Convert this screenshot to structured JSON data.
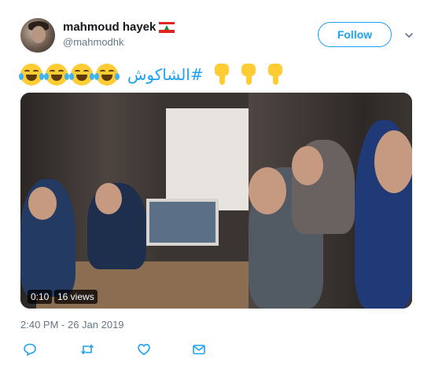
{
  "user": {
    "display_name": "mahmoud hayek",
    "handle": "@mahmodhk"
  },
  "follow_button": {
    "label": "Follow"
  },
  "tweet": {
    "hashtag": "#الشاكوش",
    "leading_emoji": [
      "face-with-tears-of-joy-icon",
      "face-with-tears-of-joy-icon",
      "face-with-tears-of-joy-icon",
      "face-with-tears-of-joy-icon"
    ],
    "trailing_emoji": [
      "backhand-index-pointing-down-icon",
      "backhand-index-pointing-down-icon",
      "backhand-index-pointing-down-icon"
    ],
    "timestamp": "2:40 PM - 26 Jan 2019"
  },
  "video": {
    "duration": "0:10",
    "views": "16 views"
  },
  "colors": {
    "accent": "#1da1f2",
    "secondary_text": "#657786",
    "primary_text": "#14171a"
  },
  "actions": [
    "reply-icon",
    "retweet-icon",
    "like-icon",
    "direct-message-icon"
  ]
}
